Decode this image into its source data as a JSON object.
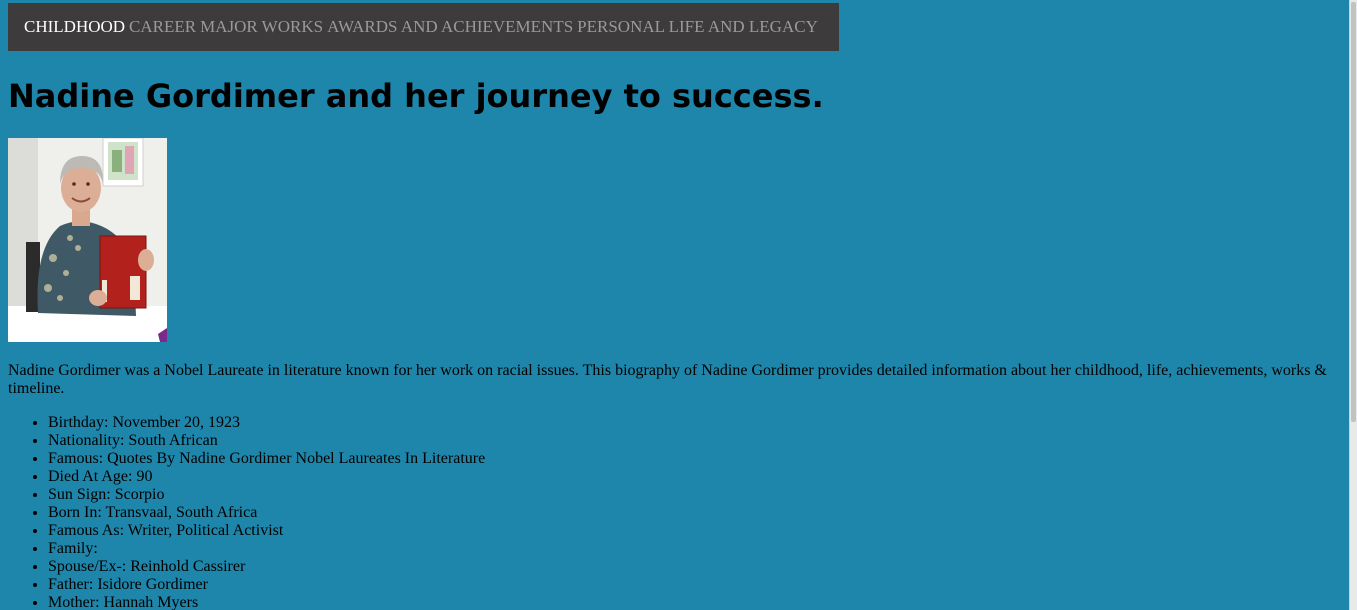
{
  "nav": {
    "items": [
      {
        "label": "CHILDHOOD",
        "active": true
      },
      {
        "label": "CAREER",
        "active": false
      },
      {
        "label": "MAJOR WORKS",
        "active": false
      },
      {
        "label": "AWARDS AND ACHIEVEMENTS",
        "active": false
      },
      {
        "label": "PERSONAL LIFE AND LEGACY",
        "active": false
      }
    ]
  },
  "page": {
    "title": "Nadine Gordimer and her journey to success.",
    "intro": "Nadine Gordimer was a Nobel Laureate in literature known for her work on racial issues. This biography of Nadine Gordimer provides detailed information about her childhood, life, achievements, works & timeline."
  },
  "facts": [
    "Birthday: November 20, 1923",
    "Nationality: South African",
    "Famous: Quotes By Nadine Gordimer Nobel Laureates In Literature",
    "Died At Age: 90",
    "Sun Sign: Scorpio",
    "Born In: Transvaal, South Africa",
    "Famous As: Writer, Political Activist",
    "Family:",
    "Spouse/Ex-: Reinhold Cassirer",
    "Father: Isidore Gordimer",
    "Mother: Hannah Myers"
  ],
  "colors": {
    "background": "#1e86aa",
    "nav_background": "#3d3b3c",
    "nav_active": "#ffffff",
    "nav_inactive": "#9a9a9a"
  }
}
